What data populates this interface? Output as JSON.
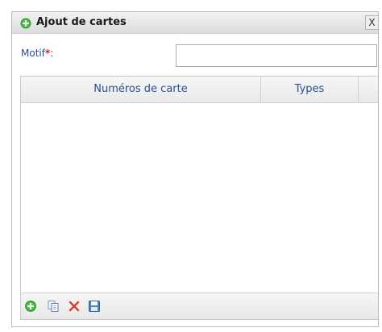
{
  "dialog": {
    "title": "Ajout de cartes",
    "close_label": "X"
  },
  "form": {
    "motif_label": "Motif",
    "required_mark": "*",
    "label_suffix": ":",
    "motif_value": ""
  },
  "grid": {
    "columns": [
      "Numéros de carte",
      "Types"
    ],
    "rows": []
  },
  "toolbar": {
    "icons": [
      "add-icon",
      "copy-icon",
      "delete-icon",
      "save-icon"
    ]
  },
  "colors": {
    "label_blue": "#2b4f94",
    "required_red": "#e01c1c",
    "add_green": "#3aa335",
    "delete_red": "#e03a2a",
    "save_blue": "#4a86c8"
  }
}
